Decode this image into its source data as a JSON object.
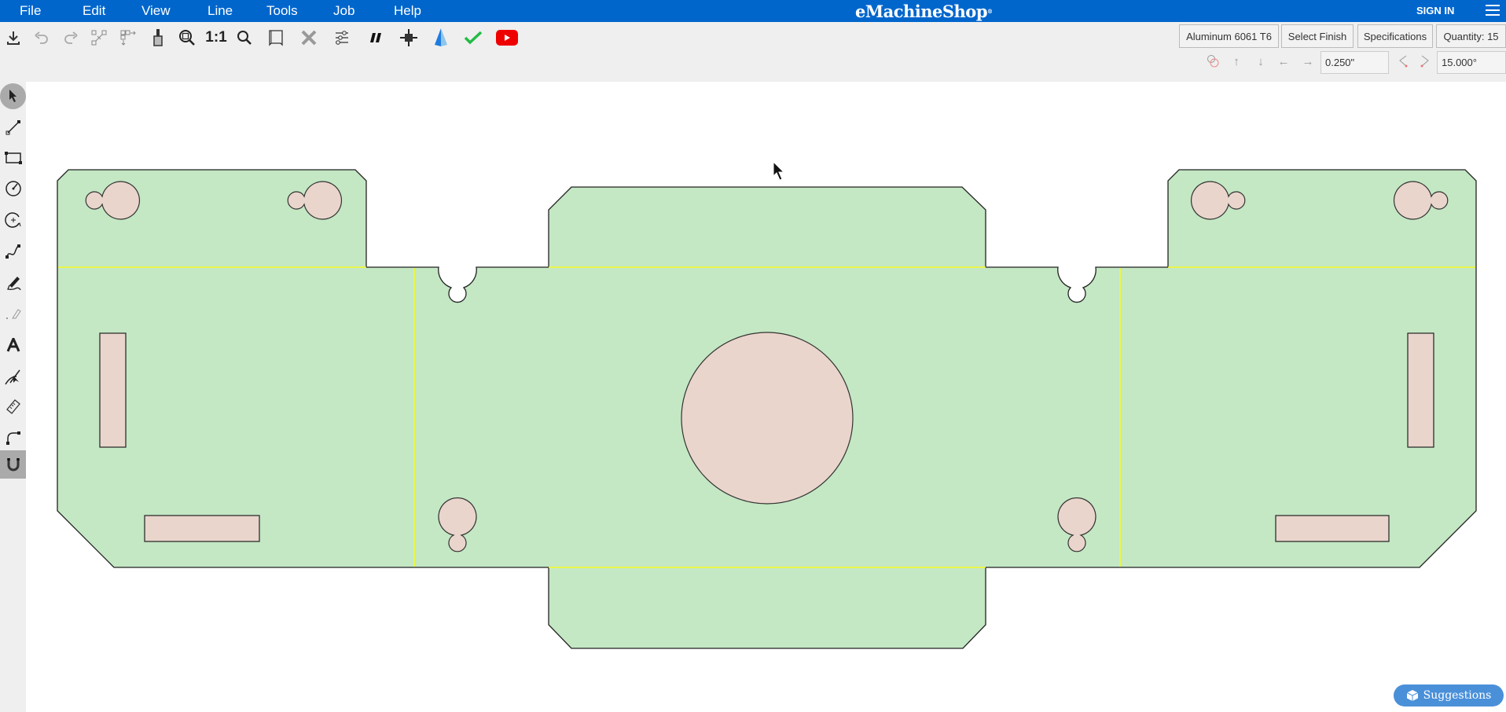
{
  "menubar": {
    "items": [
      "File",
      "Edit",
      "View",
      "Line",
      "Tools",
      "Job",
      "Help"
    ],
    "logo": "eMachineShop",
    "logo_mark": "®",
    "sign_in": "SIGN IN",
    "menu_icon": "hamburger-icon"
  },
  "toolbar": {
    "icons": [
      {
        "name": "download-icon",
        "label": "Save"
      },
      {
        "name": "undo-icon",
        "label": "Undo"
      },
      {
        "name": "redo-icon",
        "label": "Redo"
      },
      {
        "name": "group-icon",
        "label": "Group"
      },
      {
        "name": "ungroup-icon",
        "label": "Ungroup"
      },
      {
        "name": "material-thickness-icon",
        "label": "Thickness"
      },
      {
        "name": "zoom-window-icon",
        "label": "Zoom Window"
      },
      {
        "name": "zoom-1to1-icon",
        "label": "1:1"
      },
      {
        "name": "zoom-icon",
        "label": "Zoom"
      },
      {
        "name": "3d-view-icon",
        "label": "3D View"
      },
      {
        "name": "delete-icon",
        "label": "Delete"
      },
      {
        "name": "properties-icon",
        "label": "Properties"
      },
      {
        "name": "parallel-icon",
        "label": "Parallel"
      },
      {
        "name": "crosshair-icon",
        "label": "Center"
      },
      {
        "name": "pyramid-icon",
        "label": "3D"
      },
      {
        "name": "check-icon",
        "label": "Check"
      },
      {
        "name": "youtube-icon",
        "label": "Video"
      }
    ],
    "zoom_1to1_text": "1:1",
    "material_button": "Aluminum 6061 T6",
    "finish_button": "Select Finish",
    "specs_button": "Specifications",
    "quantity_button": "Quantity: 15",
    "nudge_distance": "0.250\"",
    "rotate_angle": "15.000°",
    "arrows": {
      "up": "↑",
      "down": "↓",
      "left": "←",
      "right": "→"
    }
  },
  "left_tools": [
    {
      "name": "select-tool",
      "selected": true
    },
    {
      "name": "line-tool",
      "selected": false
    },
    {
      "name": "rectangle-tool",
      "selected": false
    },
    {
      "name": "circle-tool",
      "selected": false
    },
    {
      "name": "circle-center-tool",
      "selected": false
    },
    {
      "name": "curve-tool",
      "selected": false
    },
    {
      "name": "freehand-tool",
      "selected": false
    },
    {
      "name": "eraser-tool",
      "selected": false
    },
    {
      "name": "text-tool",
      "selected": false
    },
    {
      "name": "trim-tool",
      "selected": false
    },
    {
      "name": "measure-tool",
      "selected": false
    },
    {
      "name": "fillet-tool",
      "selected": false
    },
    {
      "name": "snap-magnet-tool",
      "selected": true
    }
  ],
  "drawing": {
    "part_fill": "#c4e7c4",
    "hole_fill": "#e9d5cb",
    "outline_color": "#222222",
    "bend_line_color": "#ffff00"
  },
  "suggestions_button": "Suggestions"
}
